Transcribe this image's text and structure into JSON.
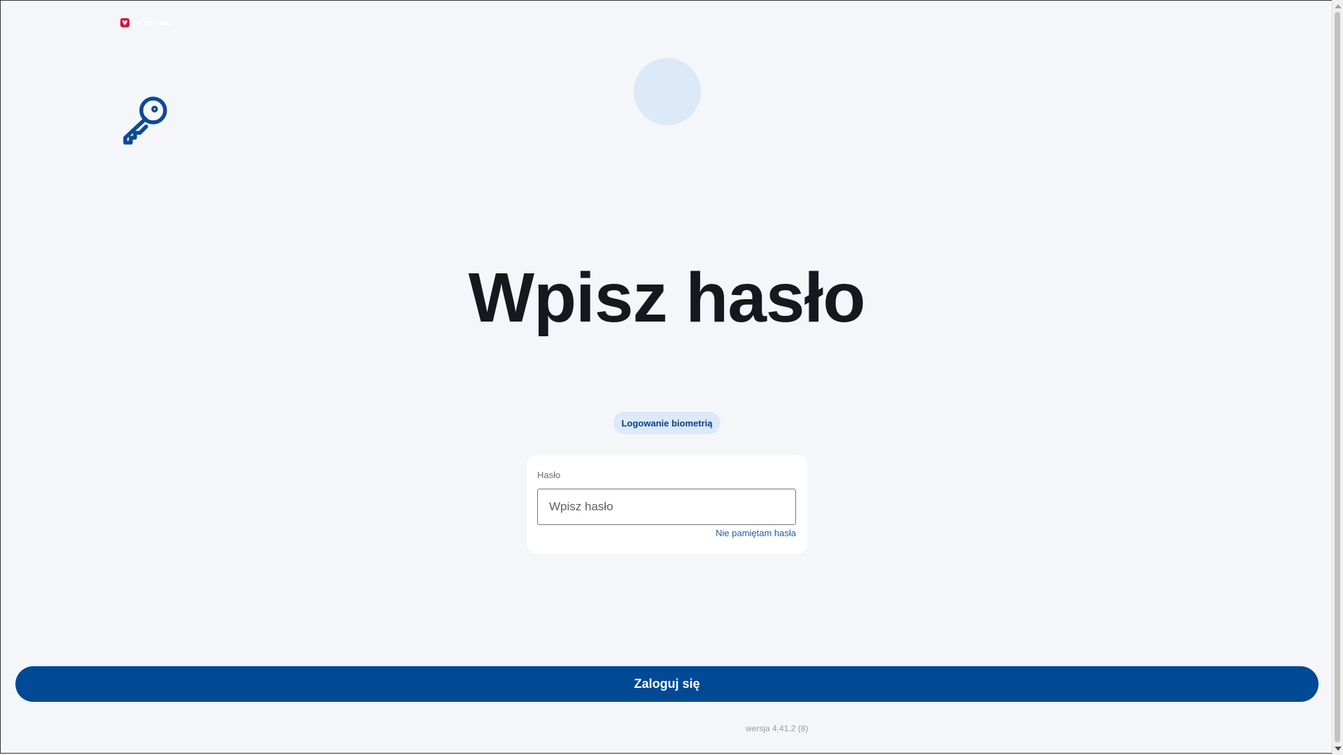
{
  "app": {
    "name": "mObywatel",
    "brand_color": "#dc143c"
  },
  "icons": {
    "logo": "eagle-badge-icon",
    "hero": "key-icon"
  },
  "main": {
    "title": "Wpisz hasło",
    "biometric_button_label": "Logowanie biometrią"
  },
  "password_form": {
    "label": "Hasło",
    "placeholder": "Wpisz hasło",
    "value": "",
    "forgot_link": "Nie pamiętam hasła"
  },
  "footer": {
    "login_button_label": "Zaloguj się",
    "version": "wersja 4.41.2 (8)"
  },
  "colors": {
    "primary": "#004a95",
    "accent_light": "#dbe9f9",
    "background": "#f5f6fa",
    "title": "#16181d"
  }
}
